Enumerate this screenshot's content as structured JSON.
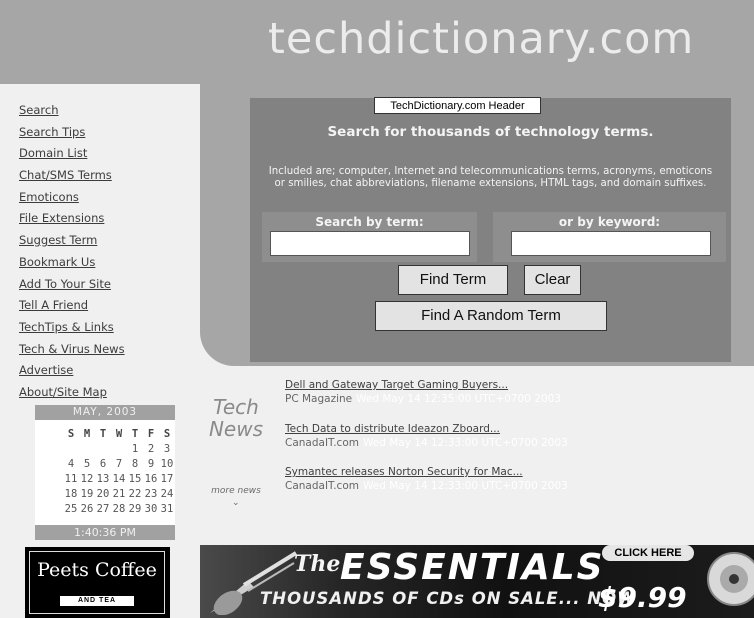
{
  "header": {
    "site_title": "techdictionary.com"
  },
  "nav": {
    "items": [
      "Search",
      "Search Tips",
      "Domain List",
      "Chat/SMS Terms",
      "Emoticons",
      "File Extensions",
      "Suggest Term",
      "Bookmark Us",
      "Add To Your Site",
      "Tell A Friend",
      "TechTips & Links",
      "Tech & Virus News",
      "Advertise",
      "About/Site Map"
    ]
  },
  "search": {
    "tooltip": "TechDictionary.com Header",
    "heading": "Search for thousands of technology terms.",
    "description": "Included are; computer, Internet and telecommunications terms, acronyms, emoticons or smilies, chat abbreviations, filename extensions, HTML tags, and domain suffixes.",
    "term_label": "Search by term:",
    "keyword_label": "or by keyword:",
    "term_value": "",
    "keyword_value": "",
    "find_term_button": "Find Term",
    "clear_button": "Clear",
    "random_button": "Find A Random Term"
  },
  "calendar": {
    "month_label": "MAY, 2003",
    "weekdays": [
      "S",
      "M",
      "T",
      "W",
      "T",
      "F",
      "S"
    ],
    "weeks": [
      [
        "",
        "",
        "",
        "",
        "1",
        "2",
        "3"
      ],
      [
        "4",
        "5",
        "6",
        "7",
        "8",
        "9",
        "10"
      ],
      [
        "11",
        "12",
        "13",
        "14",
        "15",
        "16",
        "17"
      ],
      [
        "18",
        "19",
        "20",
        "21",
        "22",
        "23",
        "24"
      ],
      [
        "25",
        "26",
        "27",
        "28",
        "29",
        "30",
        "31"
      ]
    ],
    "time": "1:40:36 PM"
  },
  "tech_news": {
    "logo_line1": "Tech",
    "logo_line2": "News",
    "more_link": "more news",
    "items": [
      {
        "title": "Dell and Gateway Target Gaming Buyers...",
        "source": "PC Magazine",
        "date": "Wed May 14 12:35:00 UTC+0700 2003"
      },
      {
        "title": "Tech Data to distribute Ideazon Zboard...",
        "source": "CanadaIT.com",
        "date": "Wed May 14 12:33:00 UTC+0700 2003"
      },
      {
        "title": "Symantec releases Norton Security for Mac...",
        "source": "CanadaIT.com",
        "date": "Wed May 14 12:33:00 UTC+0700 2003"
      }
    ]
  },
  "ads": {
    "peets": {
      "name": "Peets Coffee",
      "sub": "AND TEA"
    },
    "banner": {
      "the": "The",
      "headline": "ESSENTIALS",
      "subline": "THOUSANDS OF CDs ON SALE... NOW",
      "price": "$9.99",
      "click": "CLICK HERE"
    }
  },
  "colors": {
    "header_bg": "#a6a6a6",
    "panel_bg": "#828282",
    "page_bg": "#f0f0f0"
  }
}
